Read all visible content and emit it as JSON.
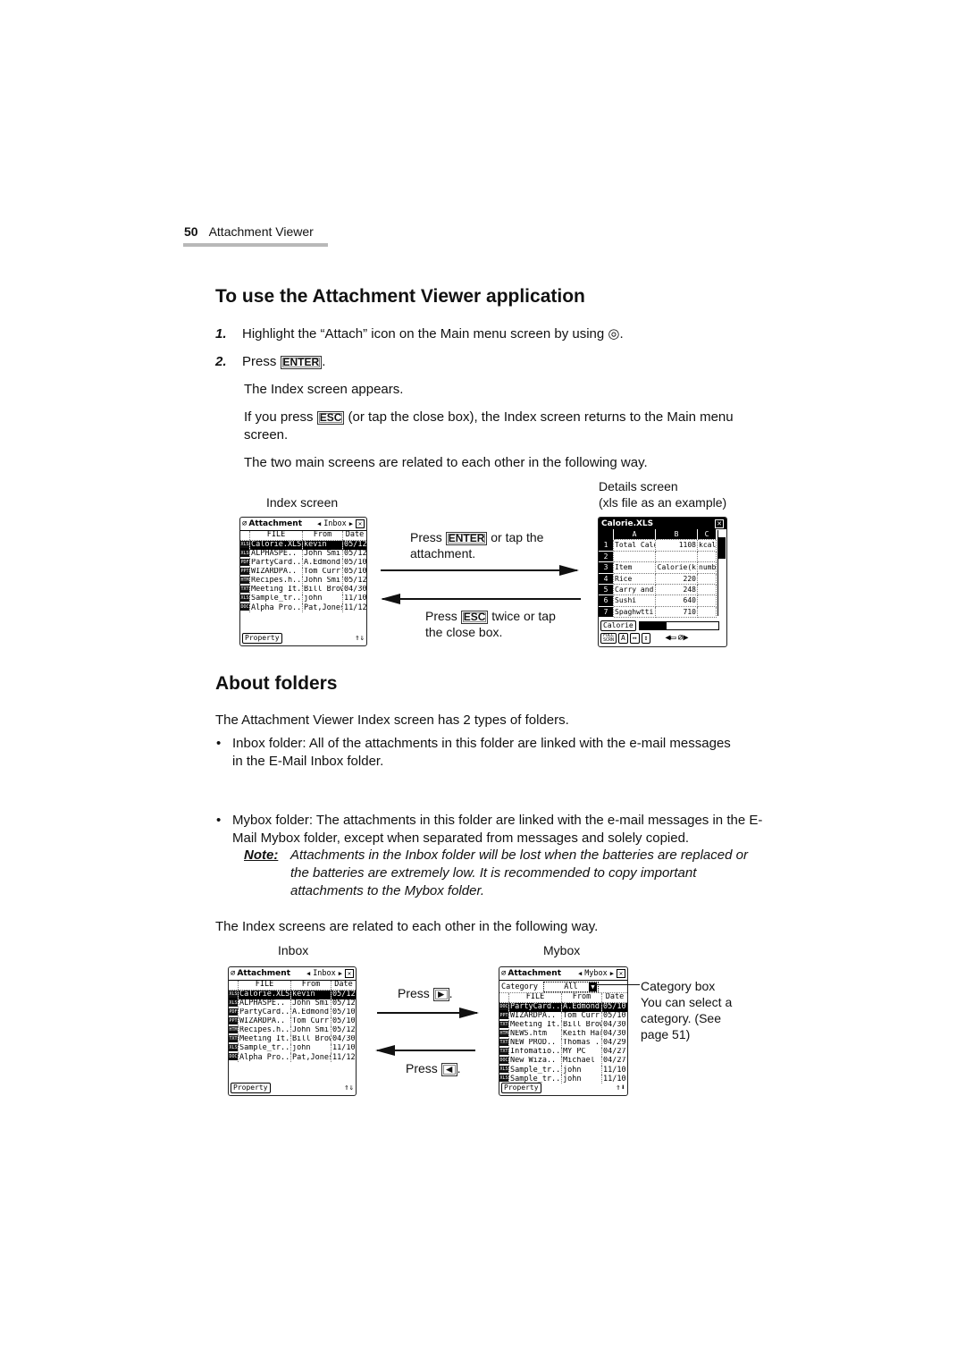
{
  "running_header": {
    "page_number": "50",
    "section": "Attachment Viewer"
  },
  "section1": {
    "title": "To use the Attachment Viewer application",
    "steps": [
      {
        "num": "1.",
        "text_before": "Highlight the “Attach” icon on the Main menu screen by using ",
        "icon": "navigation-pad-icon",
        "icon_glyph": "◎",
        "text_after": "."
      },
      {
        "num": "2.",
        "text_before": "Press ",
        "key": "ENTER",
        "text_after": "."
      }
    ],
    "p_index_appears": "The Index screen appears.",
    "p_esc_before": "If you press ",
    "p_esc_key": "ESC",
    "p_esc_after": " (or tap the close box), the Index screen returns to the Main menu screen.",
    "p_related": "The two main screens are related to each other in the following way."
  },
  "diagram1": {
    "label_left": "Index screen",
    "label_right_line1": "Details screen",
    "label_right_line2": "(xls file as an example)",
    "forward_before": "Press ",
    "forward_key": "ENTER",
    "forward_after": " or tap the attachment.",
    "back_before": "Press ",
    "back_key": "ESC",
    "back_after": " twice or tap the close box."
  },
  "inbox_screen": {
    "app_title": "Attachment",
    "folder": "Inbox",
    "columns": [
      "FILE",
      "From",
      "Date"
    ],
    "rows": [
      {
        "type": "XLS",
        "file": "Calorie.XLS",
        "from": "kevin",
        "date": "05/12",
        "selected": true
      },
      {
        "type": "XLS",
        "file": "ALPHASPE..",
        "from": "John Smi..",
        "date": "05/12"
      },
      {
        "type": "PDF",
        "file": "PartyCard..",
        "from": "A.Edmond",
        "date": "05/10"
      },
      {
        "type": "PPT",
        "file": "WIZARDPA..",
        "from": "Tom Curr..",
        "date": "05/10"
      },
      {
        "type": "HTM",
        "file": "Recipes.h..",
        "from": "John Smi..",
        "date": "05/12"
      },
      {
        "type": "TXT",
        "file": "Meeting It..",
        "from": "Bill Brown",
        "date": "04/30"
      },
      {
        "type": "XLS",
        "file": "Sample_tr..",
        "from": "john",
        "date": "11/10"
      },
      {
        "type": "DOC",
        "file": "Alpha Pro..",
        "from": "Pat,Jones",
        "date": "11/12"
      }
    ],
    "property_button": "Property",
    "scroll_glyph": "⇑⇓"
  },
  "xls_screen": {
    "title": "Calorie.XLS",
    "col_headers": [
      "A",
      "B",
      "C"
    ],
    "rows": [
      {
        "n": "1",
        "a": "Total Calo",
        "b": "1108",
        "c": "kcal"
      },
      {
        "n": "2",
        "a": "",
        "b": "",
        "c": ""
      },
      {
        "n": "3",
        "a": "Item",
        "b": "Calorie(k",
        "c": "numb"
      },
      {
        "n": "4",
        "a": "Rice",
        "b": "220",
        "c": ""
      },
      {
        "n": "5",
        "a": "Carry and",
        "b": "248",
        "c": ""
      },
      {
        "n": "6",
        "a": "Sushi",
        "b": "640",
        "c": ""
      },
      {
        "n": "7",
        "a": "Spaghwtti",
        "b": "710",
        "c": ""
      }
    ],
    "sheet_tab": "Calorie",
    "toolbar": [
      "FULL SCRN",
      "A",
      "↔",
      "↕"
    ]
  },
  "section2": {
    "title": "About folders",
    "intro": "The Attachment Viewer Index screen has 2 types of folders.",
    "bullets": [
      "Inbox folder: All of the attachments in this folder are linked with the e-mail messages in the E-Mail Inbox folder.",
      "Mybox folder: The attachments in this folder are linked with the e-mail messages in the E-Mail Mybox folder, except when separated from messages and solely copied."
    ],
    "note_label": "Note:",
    "note_text": "Attachments in the Inbox folder will be lost when the batteries are replaced or the batteries are extremely low. It is recommended to copy important attachments to the Mybox folder.",
    "p_related": "The Index screens are related to each other in the following way."
  },
  "diagram2": {
    "label_left": "Inbox",
    "label_right": "Mybox",
    "forward_text": "Press ",
    "forward_key": "►",
    "back_text": "Press ",
    "back_key": "◄",
    "callout_title": "Category box",
    "callout_text": "You can select a category. (See page 51)"
  },
  "mybox_screen": {
    "app_title": "Attachment",
    "folder": "Mybox",
    "category_label": "Category",
    "category_value": "All",
    "columns": [
      "FILE",
      "From",
      "Date"
    ],
    "rows": [
      {
        "type": "DOC",
        "file": "PartyCard..",
        "from": "A.Edmond",
        "date": "05/10",
        "selected": true
      },
      {
        "type": "PPT",
        "file": "WIZARDPA..",
        "from": "Tom Curr..",
        "date": "05/10"
      },
      {
        "type": "TXT",
        "file": "Meeting It..",
        "from": "Bill Brown",
        "date": "04/30"
      },
      {
        "type": "HTM",
        "file": "NEWS.htm",
        "from": "Keith Har..",
        "date": "04/30"
      },
      {
        "type": "TXT",
        "file": "NEW PROD..",
        "from": "Thomas ..",
        "date": "04/29"
      },
      {
        "type": "TXT",
        "file": "Infomatio..",
        "from": "MY PC",
        "date": "04/27"
      },
      {
        "type": "DOC",
        "file": "New Wiza..",
        "from": "Michael ..",
        "date": "04/27"
      },
      {
        "type": "XLS",
        "file": "Sample_tr..",
        "from": "john",
        "date": "11/10"
      },
      {
        "type": "XLS",
        "file": "Sample_tr..",
        "from": "john",
        "date": "11/10"
      }
    ],
    "property_button": "Property",
    "scroll_glyph": "⇑⬇"
  }
}
